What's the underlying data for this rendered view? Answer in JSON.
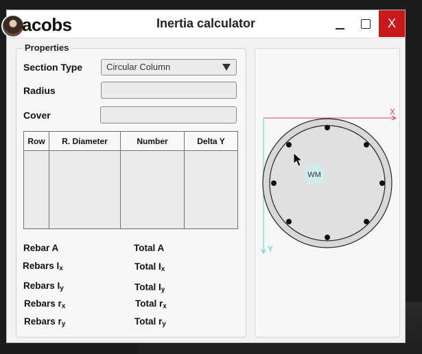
{
  "window": {
    "logo_text": "acobs",
    "title": "Inertia calculator",
    "close_label": "X"
  },
  "properties": {
    "legend": "Properties",
    "section_type_label": "Section Type",
    "section_type_value": "Circular Column",
    "radius_label": "Radius",
    "radius_value": "",
    "cover_label": "Cover",
    "cover_value": "",
    "table": {
      "headers": [
        "Row",
        "R. Diameter",
        "Number",
        "Delta Y"
      ],
      "rows": []
    },
    "results": {
      "rebar_a": "Rebar A",
      "total_a": "Total A",
      "rebars_ix": "Rebars I",
      "total_ix": "Total I",
      "rebars_iy": "Rebars I",
      "total_iy": "Total I",
      "rebars_rx": "Rebars r",
      "total_rx": "Total r",
      "rebars_ry": "Rebars r",
      "total_ry": "Total r",
      "sub_x": "x",
      "sub_y": "y"
    }
  },
  "drawing": {
    "x_axis_label": "X",
    "y_axis_label": "Y",
    "marker_label": "WM",
    "axis_color": "#e04050",
    "y_axis_color": "#40d8c0"
  }
}
